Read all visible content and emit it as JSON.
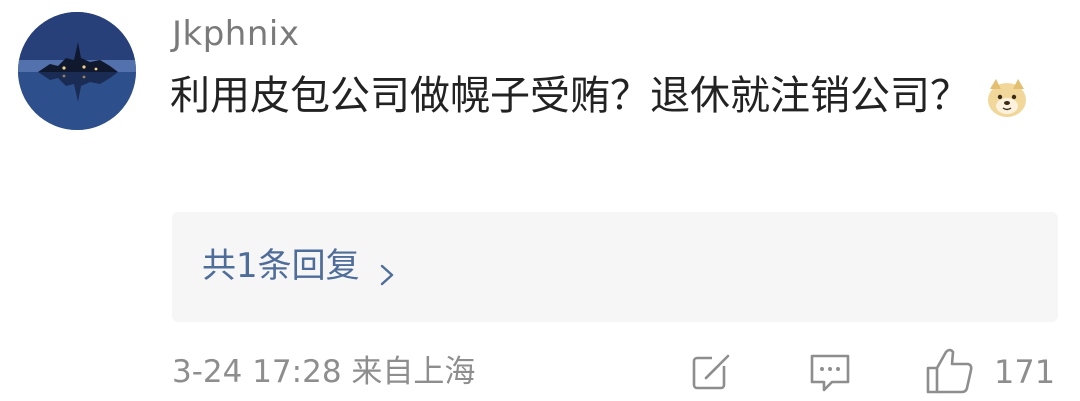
{
  "comment": {
    "username": "Jkphnix",
    "text": "利用皮包公司做幌子受贿？退休就注销公司？",
    "emoji_icon": "doge-emoji-icon",
    "reply_summary": "共1条回复",
    "reply_chevron_icon": "chevron-right-icon",
    "timestamp_source": "3-24 17:28 来自上海",
    "actions": {
      "share_icon": "share-icon",
      "comment_icon": "comment-icon",
      "like_icon": "thumbs-up-icon",
      "like_count": "171"
    }
  },
  "colors": {
    "username": "#7a7a7a",
    "text": "#222222",
    "reply_link": "#4f6d9a",
    "reply_background": "#f6f6f7",
    "meta": "#8e8e8e"
  }
}
